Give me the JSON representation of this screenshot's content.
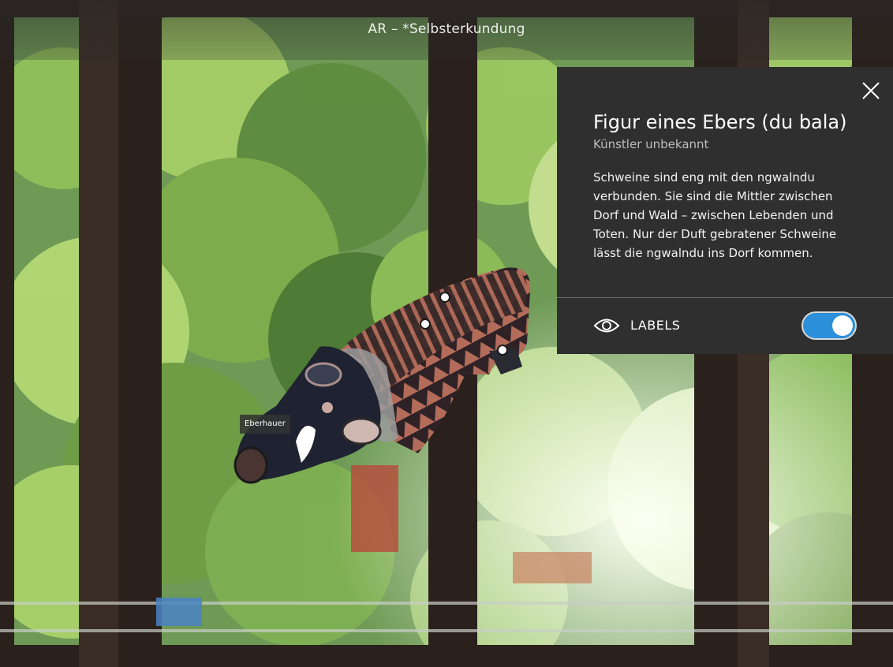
{
  "app": {
    "title": "AR – *Selbsterkundung"
  },
  "ar_object": {
    "label": "Eberhauer",
    "hotspot_count": 3
  },
  "info_panel": {
    "title": "Figur eines Ebers (du bala)",
    "subtitle": "Künstler unbekannt",
    "description": "Schweine sind eng mit den ngwalndu verbunden. Sie sind die Mittler zwischen Dorf und Wald – zwischen Lebenden und Toten. Nur der Duft gebratener Schweine lässt die ngwalndu ins Dorf kommen.",
    "close_icon": "close-icon",
    "labels_toggle": {
      "label": "LABELS",
      "icon": "eye-icon",
      "enabled": true
    }
  },
  "colors": {
    "panel_bg": "#2f2f2f",
    "toggle_on": "#2b8fd9",
    "subtitle": "#bdbdbd"
  }
}
